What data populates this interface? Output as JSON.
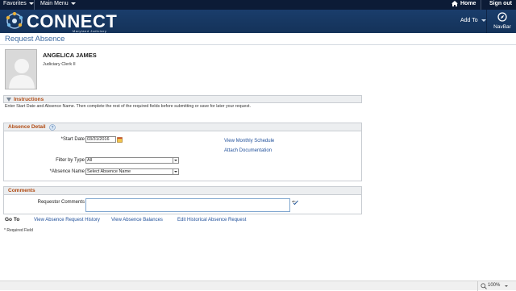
{
  "topbar": {
    "favorites": "Favorites",
    "main_menu": "Main Menu",
    "home": "Home",
    "sign_out": "Sign out"
  },
  "brand": {
    "name": "CONNECT",
    "subtitle": "Maryland Judiciary"
  },
  "header": {
    "add_to": "Add To",
    "navbar": "NavBar"
  },
  "page": {
    "title": "Request Absence"
  },
  "employee": {
    "name": "ANGELICA JAMES",
    "job_title": "Judiciary Clerk II"
  },
  "instructions": {
    "heading": "Instructions",
    "text": "Enter Start Date and Absence Name. Then complete the rest of the required fields before submitting or save for later your request."
  },
  "absence_detail": {
    "heading": "Absence Detail",
    "start_date_label": "*Start Date",
    "start_date_value": "03/31/2016",
    "filter_by_type_label": "Filter by Type",
    "filter_by_type_value": "All",
    "absence_name_label": "*Absence Name",
    "absence_name_value": "Select Absence Name",
    "view_monthly_schedule": "View Monthly Schedule",
    "attach_documentation": "Attach Documentation"
  },
  "comments": {
    "heading": "Comments",
    "requestor_label": "Requestor Comments",
    "requestor_value": ""
  },
  "goto": {
    "label": "Go To",
    "links": [
      "View Absence Request History",
      "View Absence Balances",
      "Edit Historical Absence Request"
    ]
  },
  "footnote": "* Required Field",
  "statusbar": {
    "zoom": "100%"
  },
  "colors": {
    "topbar": "#0c1b36",
    "banner": "#1a3d6b",
    "section_heading": "#b04a12",
    "link": "#1f4f9a",
    "title": "#3c6aa1"
  }
}
